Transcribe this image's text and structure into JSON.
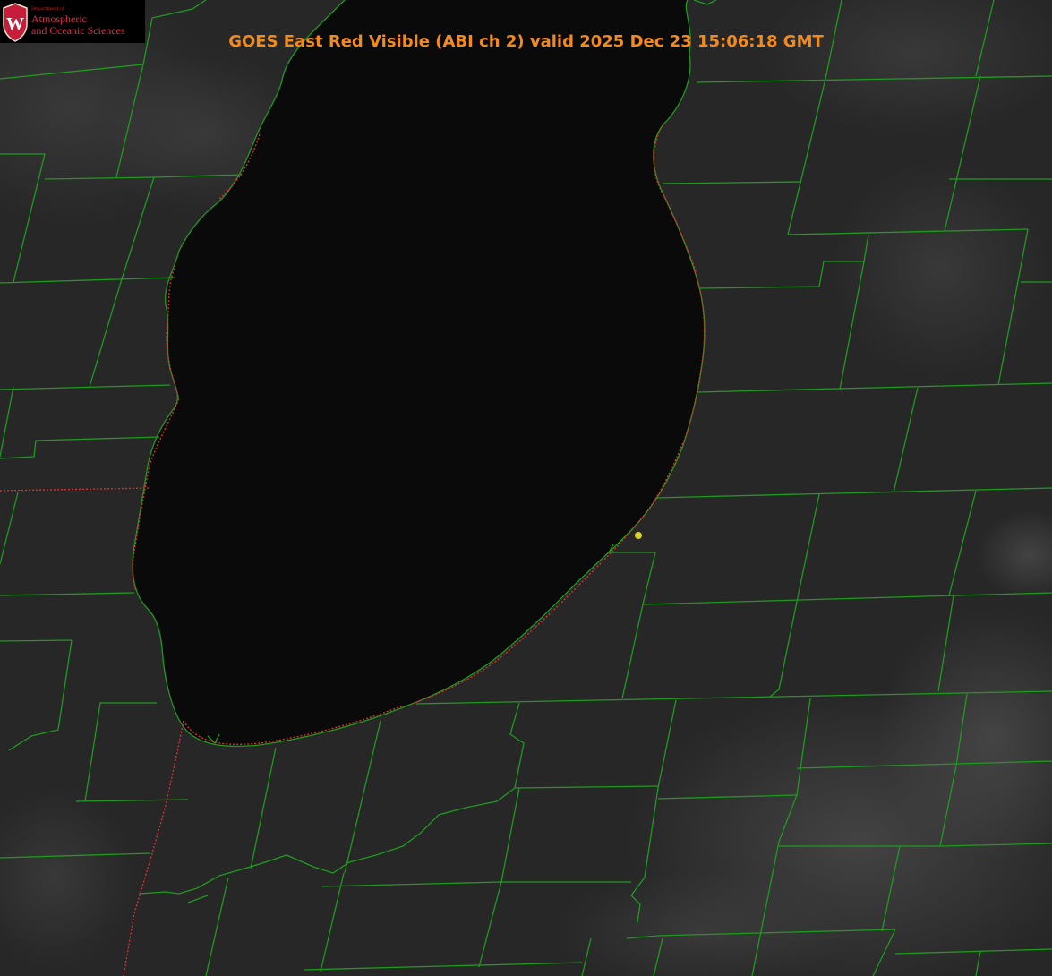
{
  "title": "GOES East Red Visible (ABI ch 2) valid 2025 Dec 23 15:06:18 GMT",
  "logo": {
    "department": "Department of",
    "line1": "Atmospheric",
    "line2": "and Oceanic Sciences",
    "seal_letter": "W"
  },
  "colors": {
    "title": "#f28a1e",
    "county_lines": "#1f9a1f",
    "state_line": "#d93030",
    "station_dot": "#d4d22a",
    "lake": "#0a0a0a",
    "land": "#2a2a2a"
  },
  "map": {
    "feature": "lake-michigan-southern-basin",
    "station_marker": "station-dot"
  }
}
